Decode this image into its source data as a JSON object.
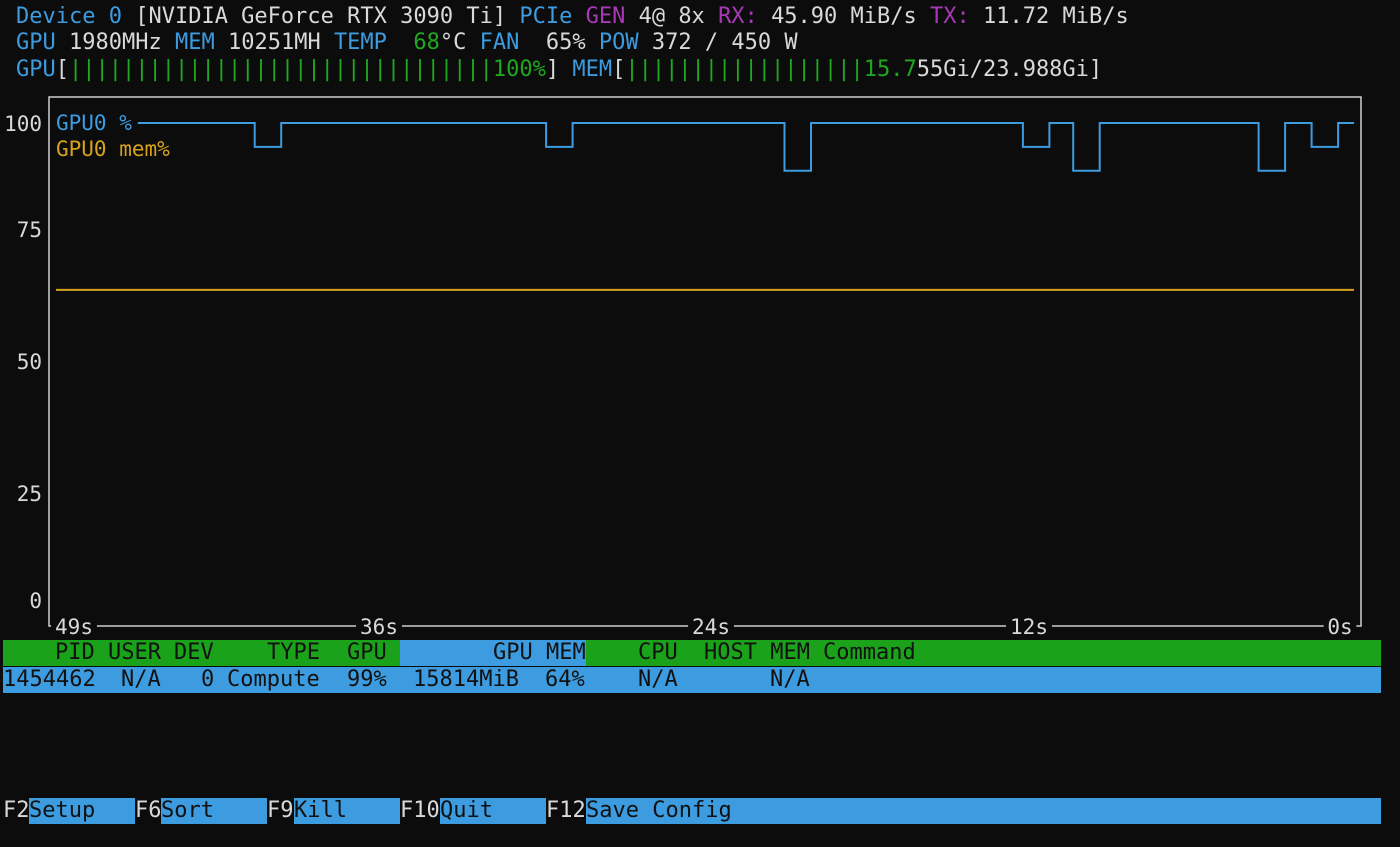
{
  "header": {
    "device_label": "Device 0",
    "device_name": "[NVIDIA GeForce RTX 3090 Ti]",
    "pcie_label": "PCIe",
    "gen_label": "GEN",
    "gen_value": "4@ 8x",
    "rx_label": "RX:",
    "rx_value": "45.90 MiB/s",
    "tx_label": "TX:",
    "tx_value": "11.72 MiB/s",
    "gpu_label": "GPU",
    "gpu_clock": "1980MHz",
    "mem_label": "MEM",
    "mem_clock": "10251MH",
    "temp_label": "TEMP",
    "temp_value": "68",
    "temp_unit": "°C",
    "fan_label": "FAN",
    "fan_value": "65%",
    "pow_label": "POW",
    "pow_value": "372 / 450 W"
  },
  "bars": {
    "gpu_label": "GPU",
    "gpu_bar": "||||||||||||||||||||||||||||||||",
    "gpu_percent": "100%",
    "gpu_fraction": 1.0,
    "mem_label": "MEM",
    "mem_bar": "||||||||||||||||||",
    "mem_used_colored": "15.7",
    "mem_used_rest": "55Gi/23.988Gi",
    "mem_fraction": 0.657
  },
  "chart_data": {
    "type": "line",
    "ylim": [
      0,
      100
    ],
    "yticks": [
      "100",
      "75",
      "50",
      "25",
      "0"
    ],
    "xtick_labels": [
      "49s",
      "36s",
      "24s",
      "12s",
      "0s"
    ],
    "xlim": [
      49,
      0
    ],
    "series": [
      {
        "name": "GPU0 %",
        "color": "#3d9be0",
        "points": [
          [
            49,
            100
          ],
          [
            41.5,
            100
          ],
          [
            41.5,
            95
          ],
          [
            40.5,
            95
          ],
          [
            40.5,
            100
          ],
          [
            30.5,
            100
          ],
          [
            30.5,
            95
          ],
          [
            29.5,
            95
          ],
          [
            29.5,
            100
          ],
          [
            21.5,
            100
          ],
          [
            21.5,
            90
          ],
          [
            20.5,
            90
          ],
          [
            20.5,
            100
          ],
          [
            12.5,
            100
          ],
          [
            12.5,
            95
          ],
          [
            11.5,
            95
          ],
          [
            11.5,
            100
          ],
          [
            10.6,
            100
          ],
          [
            10.6,
            90
          ],
          [
            9.6,
            90
          ],
          [
            9.6,
            100
          ],
          [
            3.6,
            100
          ],
          [
            3.6,
            90
          ],
          [
            2.6,
            90
          ],
          [
            2.6,
            100
          ],
          [
            1.6,
            100
          ],
          [
            1.6,
            95
          ],
          [
            0.6,
            95
          ],
          [
            0.6,
            100
          ],
          [
            0,
            100
          ]
        ]
      },
      {
        "name": "GPU0 mem%",
        "color": "#d6a21e",
        "points": [
          [
            49,
            65
          ],
          [
            0,
            65
          ]
        ]
      }
    ]
  },
  "process_table": {
    "headers": {
      "pid": "PID",
      "user": "USER",
      "dev": "DEV",
      "type": "TYPE",
      "gpu": "GPU",
      "gpu_mem": "GPU MEM",
      "cpu": "CPU",
      "host_mem": "HOST MEM",
      "command": "Command"
    },
    "rows": [
      {
        "pid": "1454462",
        "user": "N/A",
        "dev": "0",
        "type": "Compute",
        "gpu": "99%",
        "gpu_mem": "15814MiB",
        "gpu_mem_pct": "64%",
        "cpu": "N/A",
        "host_mem": "N/A",
        "command": ""
      }
    ]
  },
  "footer": [
    {
      "key": "F2",
      "label": "Setup"
    },
    {
      "key": "F6",
      "label": "Sort"
    },
    {
      "key": "F9",
      "label": "Kill"
    },
    {
      "key": "F10",
      "label": "Quit"
    },
    {
      "key": "F12",
      "label": "Save Config"
    }
  ]
}
